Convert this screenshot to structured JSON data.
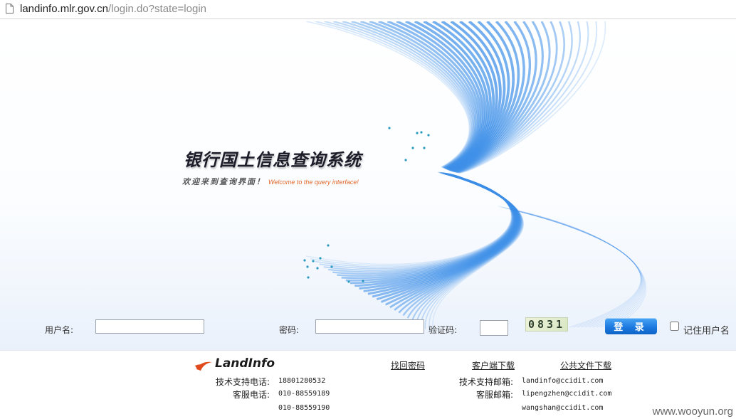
{
  "browser": {
    "url_host": "landinfo.mlr.gov.cn",
    "url_path": "/login.do?state=login"
  },
  "hero": {
    "title": "银行国土信息查询系统",
    "subtitle_cn": "欢迎来到查询界面！",
    "subtitle_en": "Welcome to the query interface!"
  },
  "login_form": {
    "username_label": "用户名:",
    "username_value": "",
    "password_label": "密码:",
    "password_value": "",
    "captcha_label": "验证码:",
    "captcha_value": "",
    "captcha_image_text": "0831",
    "login_button": "登 录",
    "remember_label": "记住用户名",
    "remember_checked": false
  },
  "footer": {
    "logo_text": "LandInfo",
    "links": {
      "forgot_password": "找回密码",
      "client_download": "客户端下载",
      "public_files": "公共文件下载"
    },
    "tech_phone_label": "技术支持电话:",
    "tech_phone": "18801280532",
    "service_phone_label": "客服电话:",
    "service_phone_1": "010-88559189",
    "service_phone_2": "010-88559190",
    "tech_email_label": "技术支持邮箱:",
    "tech_email": "landinfo@ccidit.com",
    "service_email_label": "客服邮箱:",
    "service_email_1": "lipengzhen@ccidit.com",
    "service_email_2": "wangshan@ccidit.com"
  },
  "watermark": "www.wooyun.org",
  "colors": {
    "accent_blue": "#1d7ae0",
    "swirl_blue": "#3d8fe8",
    "subtitle_orange": "#e0672a",
    "logo_red": "#e04a1c"
  }
}
